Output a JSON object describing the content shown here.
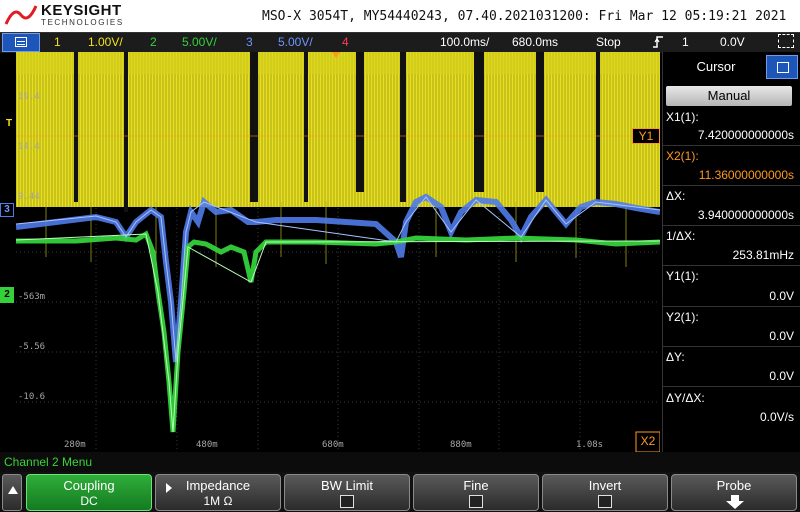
{
  "header": {
    "brand": "KEYSIGHT",
    "brand_sub": "TECHNOLOGIES",
    "instrument_id": "MSO-X 3054T, MY54440243, 07.40.2021031200: Fri Mar 12 05:19:21 2021"
  },
  "status": {
    "ch1_num": "1",
    "ch1_scale": "1.00V/",
    "ch2_num": "2",
    "ch2_scale": "5.00V/",
    "ch3_num": "3",
    "ch3_scale": "5.00V/",
    "ch4_num": "4",
    "timebase": "100.0ms/",
    "delay": "680.0ms",
    "run_state": "Stop",
    "trigger_icon": "rising-edge-icon",
    "trigger_source": "1",
    "trigger_level": "0.0V",
    "colors": {
      "ch1": "#f2e21b",
      "ch2": "#34d13b",
      "ch3": "#4f7be8",
      "ch4": "#ff3b4d"
    }
  },
  "plot": {
    "y_labels": [
      "19.4",
      "14.4",
      "9.44",
      "-563m",
      "-5.56",
      "-10.6"
    ],
    "x_labels": [
      "280m",
      "480m",
      "680m",
      "880m",
      "1.08s"
    ],
    "left_markers": {
      "trig": "T",
      "ch3": "3",
      "ch2": "2"
    },
    "cursor_y1_tag": "Y1",
    "cursor_x2_tag": "X2"
  },
  "cursor_panel": {
    "title": "Cursor",
    "mode": "Manual",
    "x1_label": "X1(1):",
    "x1_value": "7.420000000000s",
    "x2_label": "X2(1):",
    "x2_value": "11.36000000000s",
    "dx_label": "ΔX:",
    "dx_value": "3.940000000000s",
    "inv_dx_label": "1/ΔX:",
    "inv_dx_value": "253.81mHz",
    "y1_label": "Y1(1):",
    "y1_value": "0.0V",
    "y2_label": "Y2(1):",
    "y2_value": "0.0V",
    "dy_label": "ΔY:",
    "dy_value": "0.0V",
    "dydx_label": "ΔY/ΔX:",
    "dydx_value": "0.0V/s"
  },
  "menu": {
    "title": "Channel 2 Menu",
    "keys": [
      {
        "title": "Coupling",
        "value": "DC"
      },
      {
        "title": "Impedance",
        "value": "1M Ω"
      },
      {
        "title": "BW Limit",
        "value": ""
      },
      {
        "title": "Fine",
        "value": ""
      },
      {
        "title": "Invert",
        "value": ""
      },
      {
        "title": "Probe",
        "value": ""
      }
    ]
  }
}
